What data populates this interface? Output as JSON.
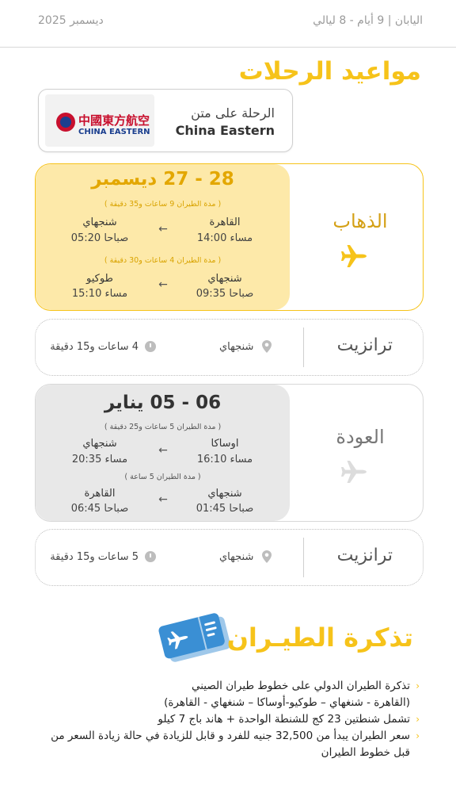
{
  "header": {
    "trip": "اليابان | 9 أيام - 8 ليالي",
    "month": "ديسمبر 2025"
  },
  "title": "مواعيد الرحلات",
  "airline": {
    "line1": "الرحلة على متن",
    "name": "China Eastern",
    "logo_cn": "中國東方航空",
    "logo_en": "CHINA EASTERN"
  },
  "outbound": {
    "label": "الذهاب",
    "date": "28 - 27 ديسمبر",
    "leg1": {
      "duration": "( مدة الطيران 9 ساعات و35 دقيقة )",
      "from_city": "القاهرة",
      "from_time": "14:00 مساء",
      "to_city": "شنجهاي",
      "to_time": "05:20 صباحا"
    },
    "leg2": {
      "duration": "( مدة الطيران 4 ساعات و30 دقيقة )",
      "from_city": "شنجهاي",
      "from_time": "09:35 صباحا",
      "to_city": "طوكيو",
      "to_time": "15:10 مساء"
    }
  },
  "transit1": {
    "label": "ترانزيت",
    "city": "شنجهاي",
    "duration": "4 ساعات و15 دقيقة"
  },
  "return": {
    "label": "العودة",
    "date": "06 - 05 يناير",
    "leg1": {
      "duration": "( مدة الطيران 5 ساعات و25 دقيقة )",
      "from_city": "اوساكا",
      "from_time": "16:10 مساء",
      "to_city": "شنجهاي",
      "to_time": "20:35 مساء"
    },
    "leg2": {
      "duration": "( مدة الطيران 5 ساعة )",
      "from_city": "شنجهاي",
      "from_time": "01:45 صباحا",
      "to_city": "القاهرة",
      "to_time": "06:45 صباحا"
    }
  },
  "transit2": {
    "label": "ترانزيت",
    "city": "شنجهاي",
    "duration": "5 ساعات و15 دقيقة"
  },
  "ticket": {
    "title": "تذكرة الطيـران",
    "bullet1_a": "تذكرة الطيران الدولي على خطوط طيران الصيني",
    "bullet1_b": "(القاهرة - شنغهاي – طوكيو-أوساكا – شنغهاي -  القاهرة)",
    "bullet2": "تشمل شنطتين 23 كج للشنطة الواحدة + هاند باج 7 كيلو",
    "bullet3_a": "سعر الطيران يبدأ من 32,500 جنيه للفرد و قابل للزيادة في حالة زيادة السعر من",
    "bullet3_b": "قبل خطوط الطيران"
  },
  "colors": {
    "accent": "#f6c31a",
    "outbound_bg": "#fde9a9",
    "return_bg": "#e8e8e8",
    "airline_red": "#c8102e",
    "airline_blue": "#1b3f8f"
  },
  "icons": {
    "outbound": "airplane-icon",
    "return": "airplane-icon",
    "transit_city": "location-pin-icon",
    "transit_time": "clock-icon",
    "ticket": "plane-ticket-icon"
  }
}
